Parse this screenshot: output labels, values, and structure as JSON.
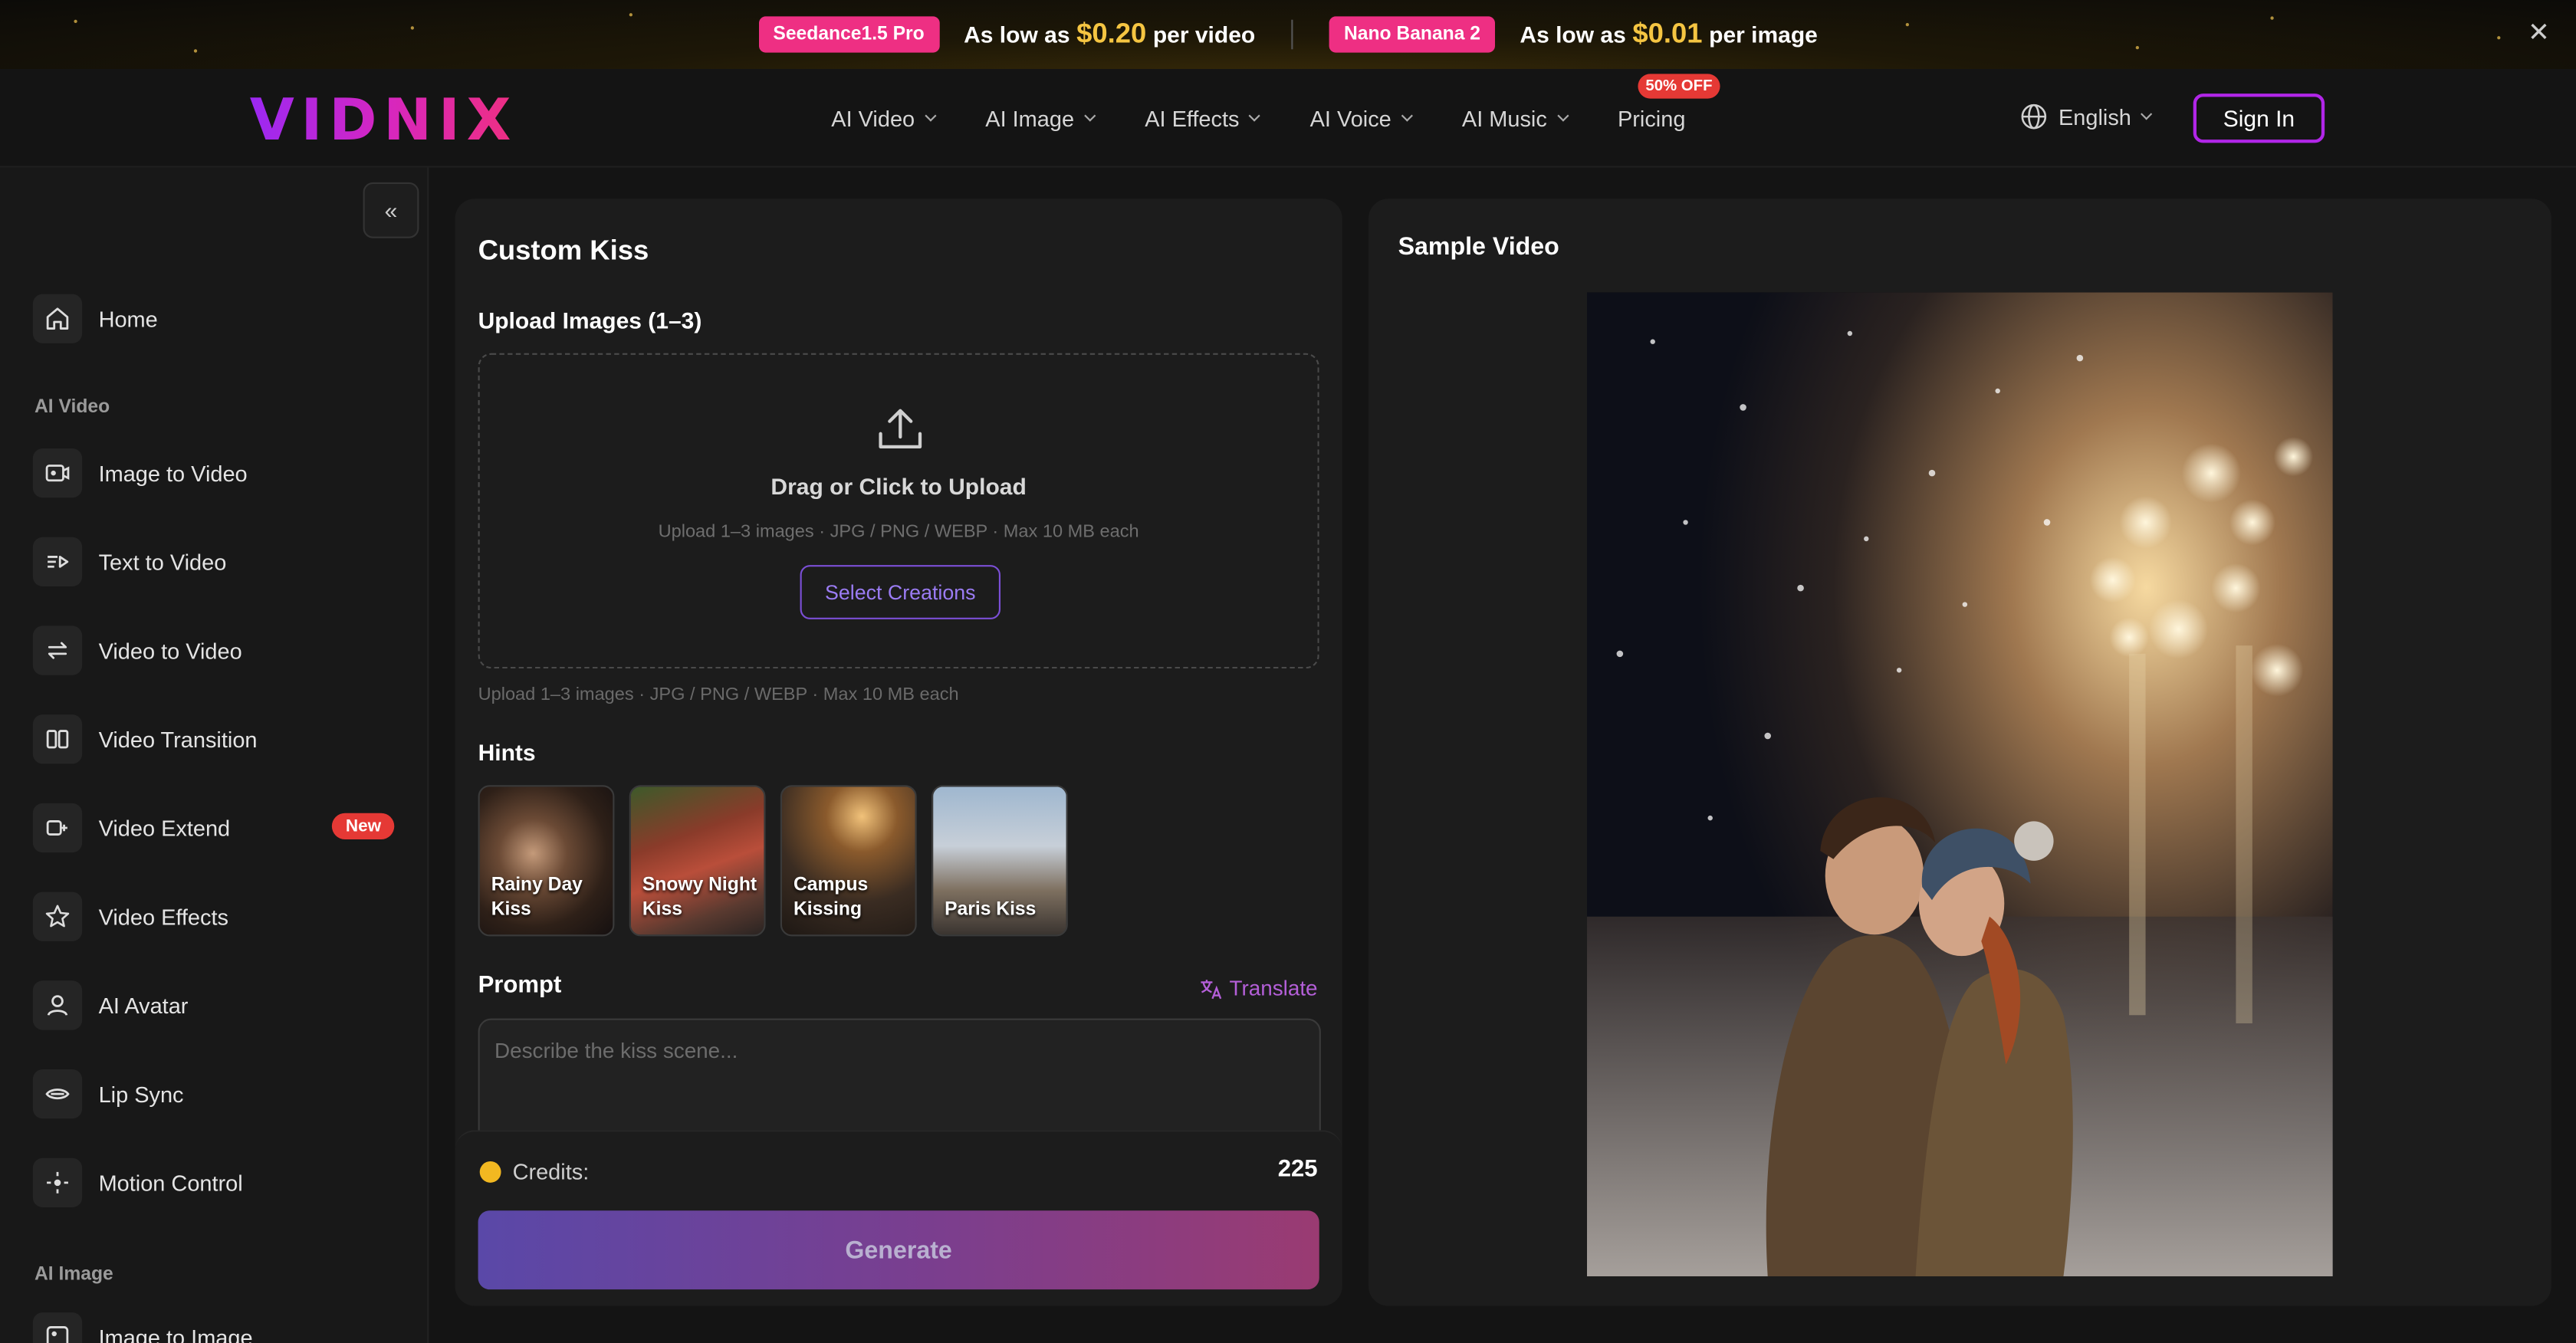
{
  "promo": {
    "left": {
      "badge": "Seedance1.5 Pro",
      "prefix": "As low as",
      "price": "$0.20",
      "suffix": "per video"
    },
    "right": {
      "badge": "Nano Banana 2",
      "prefix": "As low as",
      "price": "$0.01",
      "suffix": "per image"
    },
    "close_icon": "close-icon"
  },
  "header": {
    "logo_text": "VIDNIX",
    "nav": [
      "AI Video",
      "AI Image",
      "AI Effects",
      "AI Voice",
      "AI Music"
    ],
    "pricing": "Pricing",
    "pricing_badge": "50% OFF",
    "language": "English",
    "sign_in": "Sign In",
    "accent_color": "#b126e8"
  },
  "sidebar": {
    "home": "Home",
    "sections": [
      "AI Video",
      "AI Image"
    ],
    "items": [
      {
        "label": "Image to Video",
        "icon": "image-to-video-icon"
      },
      {
        "label": "Text to Video",
        "icon": "text-to-video-icon"
      },
      {
        "label": "Video to Video",
        "icon": "video-to-video-icon"
      },
      {
        "label": "Video Transition",
        "icon": "video-transition-icon"
      },
      {
        "label": "Video Extend",
        "icon": "video-extend-icon",
        "badge": "New"
      },
      {
        "label": "Video Effects",
        "icon": "star-icon"
      },
      {
        "label": "AI Avatar",
        "icon": "user-icon"
      },
      {
        "label": "Lip Sync",
        "icon": "lip-sync-icon"
      },
      {
        "label": "Motion Control",
        "icon": "motion-control-icon"
      }
    ],
    "image_items": [
      {
        "label": "Image to Image",
        "icon": "image-to-image-icon"
      }
    ]
  },
  "form": {
    "title": "Custom Kiss",
    "upload_title": "Upload Images (1–3)",
    "dropzone_text": "Drag or Click to Upload",
    "dropzone_sub": "Upload 1–3 images · JPG / PNG / WEBP · Max 10 MB each",
    "select_button": "Select Creations",
    "upload_note": "Upload 1–3 images · JPG / PNG / WEBP · Max 10 MB each",
    "hints_title": "Hints",
    "hints": [
      {
        "line1": "Rainy Day",
        "line2": "Kiss"
      },
      {
        "line1": "Snowy Night",
        "line2": "Kiss"
      },
      {
        "line1": "Campus",
        "line2": "Kissing"
      },
      {
        "line1": "Paris Kiss",
        "line2": ""
      }
    ],
    "prompt_title": "Prompt",
    "translate": "Translate",
    "prompt_placeholder": "Describe the kiss scene...",
    "prompt_value": "",
    "credits_label": "Credits:",
    "credits_value": "225",
    "generate": "Generate"
  },
  "sample": {
    "title": "Sample Video"
  }
}
